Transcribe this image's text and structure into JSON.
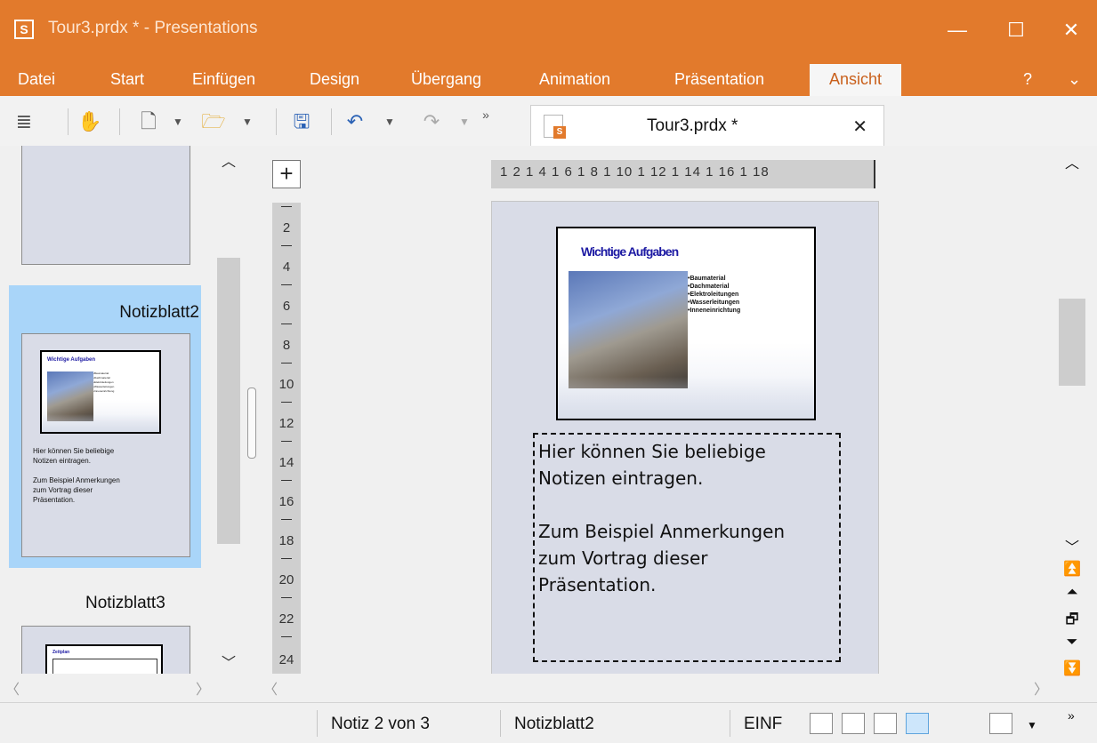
{
  "window": {
    "app_icon_letter": "S",
    "title": "Tour3.prdx * - Presentations",
    "controls": {
      "minimize": "—",
      "maximize": "☐",
      "close": "✕"
    }
  },
  "menu": {
    "items": [
      "Datei",
      "Start",
      "Einfügen",
      "Design",
      "Übergang",
      "Animation",
      "Präsentation",
      "Ansicht"
    ],
    "active": "Ansicht",
    "help": "?",
    "collapse": "⌄"
  },
  "toolbar": {
    "overflow": "»",
    "document_tab": {
      "title": "Tour3.prdx *",
      "close": "✕",
      "icon_badge": "S"
    }
  },
  "slides_panel": {
    "items": [
      {
        "label": "Notizblatt2",
        "selected": true
      },
      {
        "label": "Notizblatt3",
        "selected": false
      }
    ]
  },
  "rulers": {
    "horizontal": "1  2  1  4  1  6  1  8  1 10 1 12 1 14 1 16 1 18",
    "vertical": [
      "2",
      "4",
      "6",
      "8",
      "10",
      "12",
      "14",
      "16",
      "18",
      "20",
      "22",
      "24"
    ],
    "corner_symbol": "+"
  },
  "slide": {
    "title": "Wichtige Aufgaben",
    "bullets": [
      "•Baumaterial",
      "•Dachmaterial",
      "•Elektroleitungen",
      "•Wasserleitungen",
      "•Inneneinrichtung"
    ]
  },
  "mini_notes": "Hier können Sie beliebige\nNotizen eintragen.\n\nZum Beispiel Anmerkungen\nzum Vortrag dieser\nPräsentation.",
  "mini_slide3_title": "Zeitplan",
  "notes": {
    "text": "Hier können Sie beliebige\nNotizen eintragen.\n\nZum Beispiel Anmerkungen\nzum Vortrag dieser\nPräsentation."
  },
  "status": {
    "page": "Notiz 2 von 3",
    "slide_name": "Notizblatt2",
    "mode": "EINF",
    "overflow": "»"
  },
  "colors": {
    "titlebar": "#e27a2c",
    "selection": "#a9d5f9",
    "slide_title": "#1d1aa3"
  }
}
